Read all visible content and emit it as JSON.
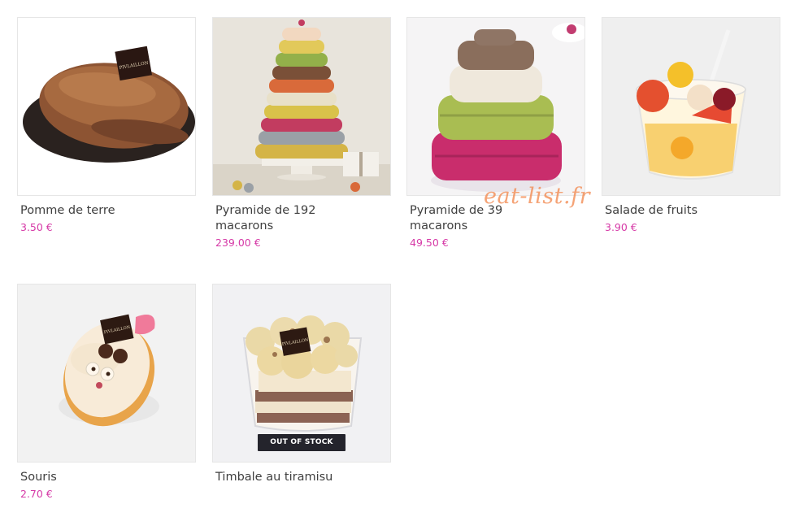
{
  "products": [
    {
      "name": "Pomme de terre",
      "price": "3.50 €"
    },
    {
      "name": "Pyramide de 192 macarons",
      "price": "239.00 €"
    },
    {
      "name": "Pyramide de 39 macarons",
      "price": "49.50 €"
    },
    {
      "name": "Salade de fruits",
      "price": "3.90 €"
    },
    {
      "name": "Souris",
      "price": "2.70 €"
    },
    {
      "name": "Timbale au tiramisu",
      "price": "",
      "badge": "OUT OF STOCK"
    }
  ],
  "brand_tag": "PIVLAILLON",
  "watermark": "eat-list.fr",
  "colors": {
    "price": "#d63aa7",
    "badge_bg": "#24242c",
    "watermark": "#f28950"
  }
}
